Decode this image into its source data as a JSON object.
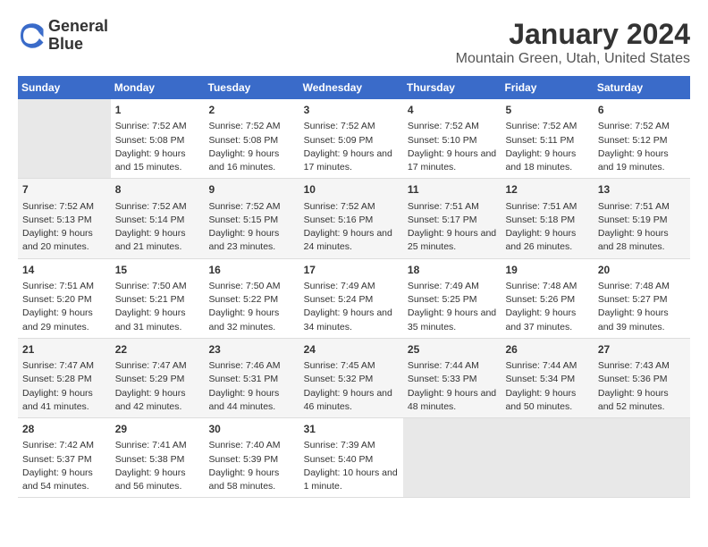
{
  "logo": {
    "line1": "General",
    "line2": "Blue"
  },
  "title": "January 2024",
  "subtitle": "Mountain Green, Utah, United States",
  "headers": [
    "Sunday",
    "Monday",
    "Tuesday",
    "Wednesday",
    "Thursday",
    "Friday",
    "Saturday"
  ],
  "weeks": [
    [
      {
        "day": "",
        "sunrise": "",
        "sunset": "",
        "daylight": ""
      },
      {
        "day": "1",
        "sunrise": "Sunrise: 7:52 AM",
        "sunset": "Sunset: 5:08 PM",
        "daylight": "Daylight: 9 hours and 15 minutes."
      },
      {
        "day": "2",
        "sunrise": "Sunrise: 7:52 AM",
        "sunset": "Sunset: 5:08 PM",
        "daylight": "Daylight: 9 hours and 16 minutes."
      },
      {
        "day": "3",
        "sunrise": "Sunrise: 7:52 AM",
        "sunset": "Sunset: 5:09 PM",
        "daylight": "Daylight: 9 hours and 17 minutes."
      },
      {
        "day": "4",
        "sunrise": "Sunrise: 7:52 AM",
        "sunset": "Sunset: 5:10 PM",
        "daylight": "Daylight: 9 hours and 17 minutes."
      },
      {
        "day": "5",
        "sunrise": "Sunrise: 7:52 AM",
        "sunset": "Sunset: 5:11 PM",
        "daylight": "Daylight: 9 hours and 18 minutes."
      },
      {
        "day": "6",
        "sunrise": "Sunrise: 7:52 AM",
        "sunset": "Sunset: 5:12 PM",
        "daylight": "Daylight: 9 hours and 19 minutes."
      }
    ],
    [
      {
        "day": "7",
        "sunrise": "Sunrise: 7:52 AM",
        "sunset": "Sunset: 5:13 PM",
        "daylight": "Daylight: 9 hours and 20 minutes."
      },
      {
        "day": "8",
        "sunrise": "Sunrise: 7:52 AM",
        "sunset": "Sunset: 5:14 PM",
        "daylight": "Daylight: 9 hours and 21 minutes."
      },
      {
        "day": "9",
        "sunrise": "Sunrise: 7:52 AM",
        "sunset": "Sunset: 5:15 PM",
        "daylight": "Daylight: 9 hours and 23 minutes."
      },
      {
        "day": "10",
        "sunrise": "Sunrise: 7:52 AM",
        "sunset": "Sunset: 5:16 PM",
        "daylight": "Daylight: 9 hours and 24 minutes."
      },
      {
        "day": "11",
        "sunrise": "Sunrise: 7:51 AM",
        "sunset": "Sunset: 5:17 PM",
        "daylight": "Daylight: 9 hours and 25 minutes."
      },
      {
        "day": "12",
        "sunrise": "Sunrise: 7:51 AM",
        "sunset": "Sunset: 5:18 PM",
        "daylight": "Daylight: 9 hours and 26 minutes."
      },
      {
        "day": "13",
        "sunrise": "Sunrise: 7:51 AM",
        "sunset": "Sunset: 5:19 PM",
        "daylight": "Daylight: 9 hours and 28 minutes."
      }
    ],
    [
      {
        "day": "14",
        "sunrise": "Sunrise: 7:51 AM",
        "sunset": "Sunset: 5:20 PM",
        "daylight": "Daylight: 9 hours and 29 minutes."
      },
      {
        "day": "15",
        "sunrise": "Sunrise: 7:50 AM",
        "sunset": "Sunset: 5:21 PM",
        "daylight": "Daylight: 9 hours and 31 minutes."
      },
      {
        "day": "16",
        "sunrise": "Sunrise: 7:50 AM",
        "sunset": "Sunset: 5:22 PM",
        "daylight": "Daylight: 9 hours and 32 minutes."
      },
      {
        "day": "17",
        "sunrise": "Sunrise: 7:49 AM",
        "sunset": "Sunset: 5:24 PM",
        "daylight": "Daylight: 9 hours and 34 minutes."
      },
      {
        "day": "18",
        "sunrise": "Sunrise: 7:49 AM",
        "sunset": "Sunset: 5:25 PM",
        "daylight": "Daylight: 9 hours and 35 minutes."
      },
      {
        "day": "19",
        "sunrise": "Sunrise: 7:48 AM",
        "sunset": "Sunset: 5:26 PM",
        "daylight": "Daylight: 9 hours and 37 minutes."
      },
      {
        "day": "20",
        "sunrise": "Sunrise: 7:48 AM",
        "sunset": "Sunset: 5:27 PM",
        "daylight": "Daylight: 9 hours and 39 minutes."
      }
    ],
    [
      {
        "day": "21",
        "sunrise": "Sunrise: 7:47 AM",
        "sunset": "Sunset: 5:28 PM",
        "daylight": "Daylight: 9 hours and 41 minutes."
      },
      {
        "day": "22",
        "sunrise": "Sunrise: 7:47 AM",
        "sunset": "Sunset: 5:29 PM",
        "daylight": "Daylight: 9 hours and 42 minutes."
      },
      {
        "day": "23",
        "sunrise": "Sunrise: 7:46 AM",
        "sunset": "Sunset: 5:31 PM",
        "daylight": "Daylight: 9 hours and 44 minutes."
      },
      {
        "day": "24",
        "sunrise": "Sunrise: 7:45 AM",
        "sunset": "Sunset: 5:32 PM",
        "daylight": "Daylight: 9 hours and 46 minutes."
      },
      {
        "day": "25",
        "sunrise": "Sunrise: 7:44 AM",
        "sunset": "Sunset: 5:33 PM",
        "daylight": "Daylight: 9 hours and 48 minutes."
      },
      {
        "day": "26",
        "sunrise": "Sunrise: 7:44 AM",
        "sunset": "Sunset: 5:34 PM",
        "daylight": "Daylight: 9 hours and 50 minutes."
      },
      {
        "day": "27",
        "sunrise": "Sunrise: 7:43 AM",
        "sunset": "Sunset: 5:36 PM",
        "daylight": "Daylight: 9 hours and 52 minutes."
      }
    ],
    [
      {
        "day": "28",
        "sunrise": "Sunrise: 7:42 AM",
        "sunset": "Sunset: 5:37 PM",
        "daylight": "Daylight: 9 hours and 54 minutes."
      },
      {
        "day": "29",
        "sunrise": "Sunrise: 7:41 AM",
        "sunset": "Sunset: 5:38 PM",
        "daylight": "Daylight: 9 hours and 56 minutes."
      },
      {
        "day": "30",
        "sunrise": "Sunrise: 7:40 AM",
        "sunset": "Sunset: 5:39 PM",
        "daylight": "Daylight: 9 hours and 58 minutes."
      },
      {
        "day": "31",
        "sunrise": "Sunrise: 7:39 AM",
        "sunset": "Sunset: 5:40 PM",
        "daylight": "Daylight: 10 hours and 1 minute."
      },
      {
        "day": "",
        "sunrise": "",
        "sunset": "",
        "daylight": ""
      },
      {
        "day": "",
        "sunrise": "",
        "sunset": "",
        "daylight": ""
      },
      {
        "day": "",
        "sunrise": "",
        "sunset": "",
        "daylight": ""
      }
    ]
  ]
}
